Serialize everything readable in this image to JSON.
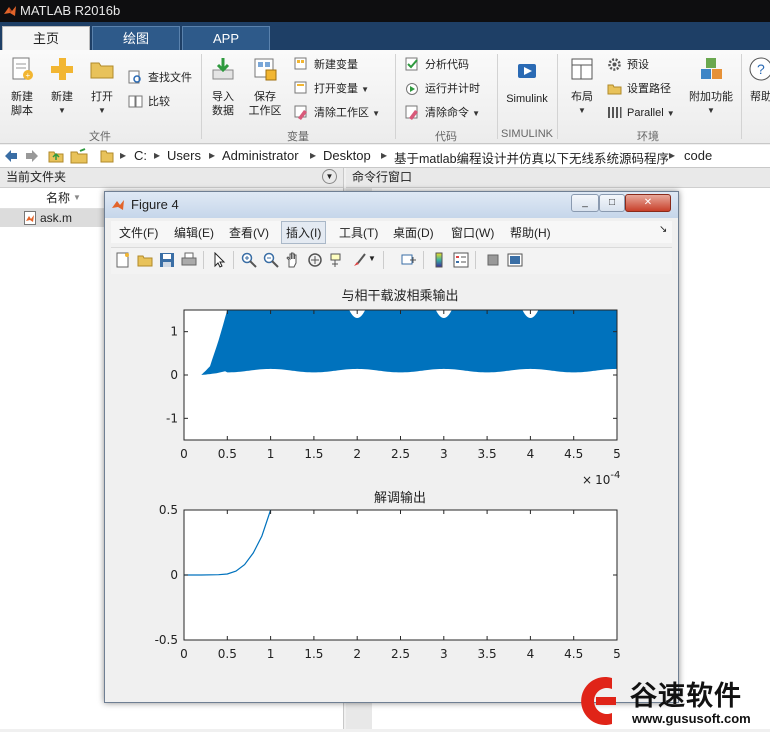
{
  "app": {
    "title": "MATLAB R2016b"
  },
  "tabs": [
    {
      "label": "主页"
    },
    {
      "label": "绘图"
    },
    {
      "label": "APP"
    }
  ],
  "ribbon": {
    "file": {
      "group_label": "文件",
      "new_script": "新建\n脚本",
      "new": "新建",
      "open": "打开",
      "find_files": "查找文件",
      "compare": "比较"
    },
    "variable": {
      "group_label": "变量",
      "import_data": "导入\n数据",
      "save_workspace": "保存\n工作区",
      "new_variable": "新建变量",
      "open_variable": "打开变量",
      "clear_workspace": "清除工作区"
    },
    "code": {
      "group_label": "代码",
      "analyze_code": "分析代码",
      "run_and_time": "运行并计时",
      "clear_commands": "清除命令"
    },
    "simulink": {
      "group_label": "SIMULINK",
      "simulink": "Simulink"
    },
    "environment": {
      "group_label": "环境",
      "layout": "布局",
      "preferences": "预设",
      "set_path": "设置路径",
      "parallel": "Parallel",
      "addons": "附加功能",
      "help": "帮助"
    }
  },
  "address_bar": {
    "crumbs": [
      "C:",
      "Users",
      "Administrator",
      "Desktop",
      "基于matlab编程设计并仿真以下无线系统源码程序",
      "code"
    ]
  },
  "current_folder": {
    "title": "当前文件夹",
    "column_name": "名称",
    "files": [
      {
        "name": "ask.m"
      }
    ]
  },
  "command_window": {
    "title": "命令行窗口"
  },
  "figure": {
    "title": "Figure 4",
    "menu": [
      "文件(F)",
      "编辑(E)",
      "查看(V)",
      "插入(I)",
      "工具(T)",
      "桌面(D)",
      "窗口(W)",
      "帮助(H)"
    ],
    "toolbar_icons": [
      "new-figure-icon",
      "open-file-icon",
      "save-icon",
      "print-icon",
      "pointer-icon",
      "zoom-in-icon",
      "zoom-out-icon",
      "pan-hand-icon",
      "rotate-3d-icon",
      "data-cursor-icon",
      "brush-icon",
      "link-plot-icon",
      "colorbar-icon",
      "legend-icon",
      "hide-plot-tools-icon",
      "show-plot-tools-icon"
    ]
  },
  "chart_data": [
    {
      "type": "area",
      "title": "与相干载波相乘输出",
      "x_tick_labels": [
        "0",
        "0.5",
        "1",
        "1.5",
        "2",
        "2.5",
        "3",
        "3.5",
        "4",
        "4.5",
        "5"
      ],
      "x_exponent": "× 10^-4",
      "y_tick_labels": [
        "1",
        "0",
        "-1"
      ],
      "xlim": [
        0,
        0.0005
      ],
      "ylim": [
        -1.5,
        1.5
      ],
      "color": "#0072bd",
      "series": [
        {
          "x": [
            0,
            2e-05,
            3e-05,
            4e-05,
            5e-05,
            0.0001,
            0.00015,
            0.0002,
            0.00025,
            0.0003,
            0.00035,
            0.0004,
            0.00045,
            0.0005
          ],
          "lower": [
            0,
            0,
            0.02,
            0.05,
            0.1,
            0.14,
            0.06,
            0.14,
            0.06,
            0.14,
            0.06,
            0.14,
            0.06,
            0.14
          ],
          "upper": [
            0,
            0,
            0.2,
            0.8,
            1.5,
            1.5,
            1.5,
            1.5,
            1.5,
            1.5,
            1.5,
            1.5,
            1.5,
            1.5
          ]
        }
      ]
    },
    {
      "type": "line",
      "title": "解调输出",
      "x_tick_labels": [
        "0",
        "0.5",
        "1",
        "1.5",
        "2",
        "2.5",
        "3",
        "3.5",
        "4",
        "4.5",
        "5"
      ],
      "y_tick_labels": [
        "0.5",
        "0",
        "-0.5"
      ],
      "xlim": [
        0,
        0.0005
      ],
      "ylim": [
        -0.5,
        0.5
      ],
      "color": "#0072bd",
      "series": [
        {
          "x": [
            0,
            2e-05,
            4e-05,
            5e-05,
            6e-05,
            7e-05,
            8e-05,
            9e-05,
            0.0001
          ],
          "y": [
            0,
            0,
            0.002,
            0.008,
            0.03,
            0.08,
            0.17,
            0.3,
            0.5
          ]
        }
      ]
    }
  ],
  "watermark": {
    "brand": "谷速软件",
    "url": "www.gususoft.com"
  }
}
